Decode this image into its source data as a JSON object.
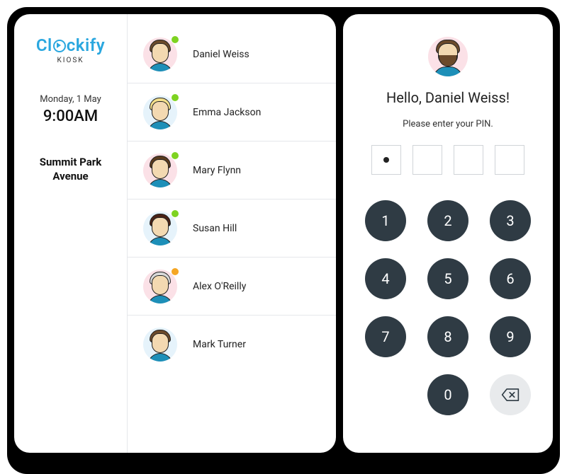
{
  "brand": {
    "name_pre": "Cl",
    "name_post": "ckify",
    "sub": "KIOSK",
    "accent": "#2aa7df"
  },
  "datetime": {
    "date": "Monday, 1 May",
    "time": "9:00AM"
  },
  "location": {
    "line1": "Summit Park",
    "line2": "Avenue"
  },
  "status_colors": {
    "online": "#7ed321",
    "away": "#f5a623"
  },
  "users": [
    {
      "name": "Daniel Weiss",
      "status": "online",
      "avatar_bg": "#fbe1e7",
      "hair": "#6b4a2b",
      "shirt": "#1d8fb8"
    },
    {
      "name": "Emma Jackson",
      "status": "online",
      "avatar_bg": "#e6f3fb",
      "hair": "#f4e08a",
      "shirt": "#1d8fb8"
    },
    {
      "name": "Mary Flynn",
      "status": "online",
      "avatar_bg": "#fbe1e7",
      "hair": "#5b3b1e",
      "shirt": "#1d8fb8"
    },
    {
      "name": "Susan Hill",
      "status": "online",
      "avatar_bg": "#e6f3fb",
      "hair": "#4a2316",
      "shirt": "#1d8fb8"
    },
    {
      "name": "Alex O'Reilly",
      "status": "away",
      "avatar_bg": "#fbe1e7",
      "hair": "#d8d8d8",
      "shirt": "#1d8fb8"
    },
    {
      "name": "Mark Turner",
      "status": "none",
      "avatar_bg": "#e6f3fb",
      "hair": "#6b4a2b",
      "shirt": "#1d8fb8"
    }
  ],
  "pin": {
    "greeting": "Hello, Daniel Weiss!",
    "prompt": "Please enter your PIN.",
    "length": 4,
    "entered": 1,
    "user_avatar_bg": "#fbe1e7",
    "user_hair": "#6b4a2b",
    "user_shirt": "#1d8fb8"
  },
  "keypad": {
    "keys": [
      "1",
      "2",
      "3",
      "4",
      "5",
      "6",
      "7",
      "8",
      "9",
      "0"
    ],
    "backspace_icon": "backspace-icon"
  }
}
